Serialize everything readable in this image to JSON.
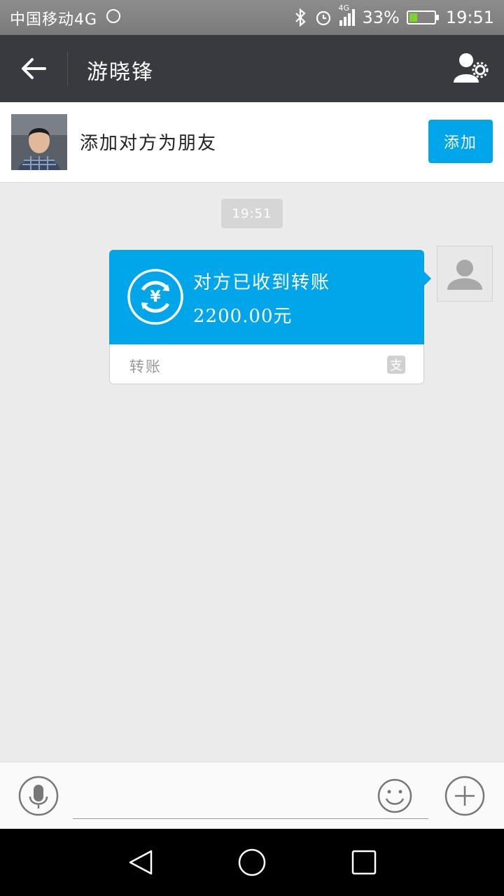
{
  "status_bar": {
    "carrier": "中国移动4G",
    "network_badge": "4G",
    "battery_percent": "33%",
    "battery_level": 0.33,
    "time": "19:51"
  },
  "title_bar": {
    "contact_name": "游晓锋"
  },
  "add_friend": {
    "prompt": "添加对方为朋友",
    "button_label": "添加"
  },
  "chat": {
    "timestamp": "19:51",
    "transfer": {
      "status": "对方已收到转账",
      "amount": "2200.00元",
      "label": "转账",
      "icon_char": "¥",
      "provider_icon": "支"
    }
  },
  "input_bar": {
    "placeholder": ""
  },
  "colors": {
    "accent": "#00a6e9",
    "title_bar": "#393a3f",
    "chat_bg": "#ebebeb"
  }
}
